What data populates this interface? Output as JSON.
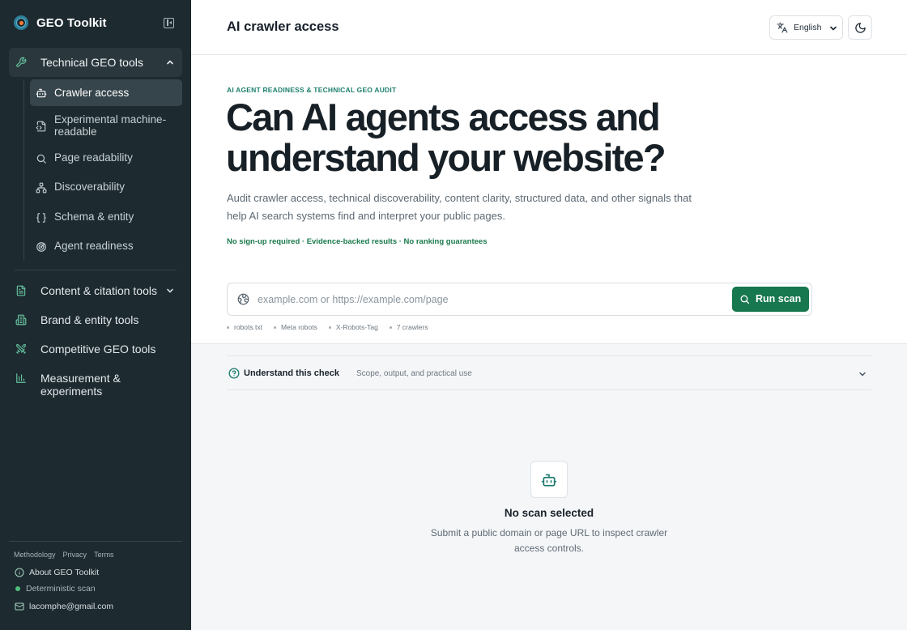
{
  "app": {
    "name": "GEO Toolkit"
  },
  "sidebar": {
    "group": {
      "label": "Technical GEO tools",
      "icon": "wrench-icon",
      "expanded": true
    },
    "sub_items": [
      {
        "label": "Crawler access",
        "icon": "robot-icon",
        "active": true
      },
      {
        "label": "Experimental machine-readable",
        "icon": "file-code-icon",
        "active": false
      },
      {
        "label": "Page readability",
        "icon": "search-icon",
        "active": false
      },
      {
        "label": "Discoverability",
        "icon": "sitemap-icon",
        "active": false
      },
      {
        "label": "Schema & entity",
        "icon": "braces-icon",
        "active": false
      },
      {
        "label": "Agent readiness",
        "icon": "radar-icon",
        "active": false
      }
    ],
    "main_items": [
      {
        "label": "Content & citation tools",
        "icon": "document-icon",
        "has_chevron": true
      },
      {
        "label": "Brand & entity tools",
        "icon": "building-icon",
        "has_chevron": false
      },
      {
        "label": "Competitive GEO tools",
        "icon": "swords-icon",
        "has_chevron": false
      },
      {
        "label": "Measurement & experiments",
        "icon": "bar-chart-icon",
        "has_chevron": false
      }
    ],
    "footer": {
      "links": [
        "Methodology",
        "Privacy",
        "Terms"
      ],
      "about": "About GEO Toolkit",
      "status": "Deterministic scan",
      "email": "lacomphe@gmail.com"
    }
  },
  "header": {
    "title": "AI crawler access",
    "language": "English"
  },
  "hero": {
    "eyebrow": "AI AGENT READINESS & TECHNICAL GEO AUDIT",
    "headline_line1": "Can AI agents access and",
    "headline_line2": "understand your website?",
    "lead": "Audit crawler access, technical discoverability, content clarity, structured data, and other signals that help AI search systems find and interpret your public pages.",
    "tagline": "No sign-up required · Evidence-backed results · No ranking guarantees"
  },
  "search": {
    "placeholder": "example.com or https://example.com/page",
    "value": "",
    "button_label": "Run scan",
    "chips": [
      "robots.txt",
      "Meta robots",
      "X-Robots-Tag",
      "7 crawlers"
    ]
  },
  "check": {
    "title": "Understand this check",
    "subtitle": "Scope, output, and practical use"
  },
  "empty_state": {
    "title": "No scan selected",
    "description": "Submit a public domain or page URL to inspect crawler access controls."
  },
  "colors": {
    "sidebar_bg": "#1d2a30",
    "accent_green": "#17774f",
    "accent_teal": "#1d7f6e"
  }
}
